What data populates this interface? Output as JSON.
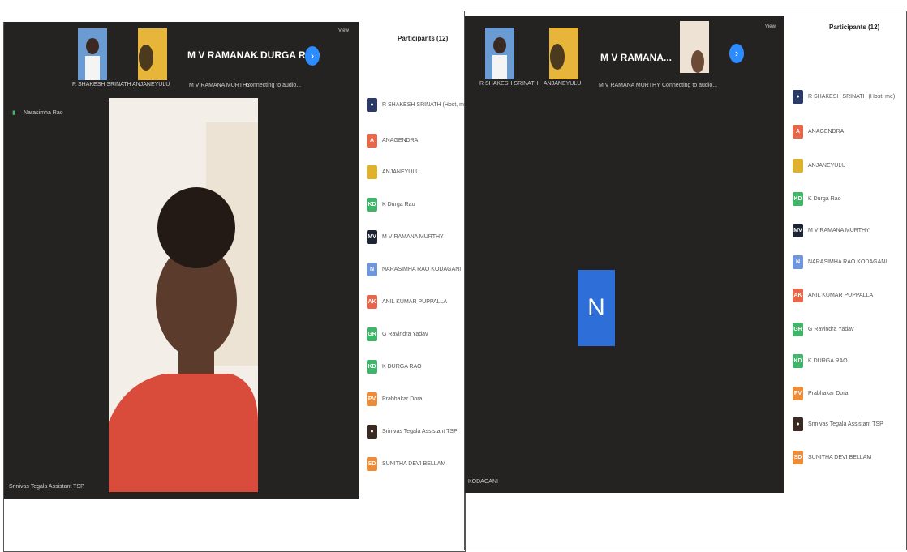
{
  "left": {
    "thumbs": [
      {
        "label": "R SHAKESH SRINATH"
      },
      {
        "label": "ANJANEYULU"
      }
    ],
    "speaker_left": "M V RAMANA...",
    "speaker_right": "K DURGA RAO",
    "sub_labels": [
      "M V RAMANA MURTHY",
      "Connecting to audio..."
    ],
    "view_label": "View",
    "top_status": "Narasimha Rao",
    "bottom_name": "Srinivas Tegala Assistant TSP",
    "participants_title": "Participants (12)",
    "participants": [
      {
        "initials": "",
        "name": "R SHAKESH SRINATH (Host, me)",
        "color": "#2b3a67",
        "type": "photo"
      },
      {
        "initials": "A",
        "name": "ANAGENDRA",
        "color": "#e8674a"
      },
      {
        "initials": "",
        "name": "ANJANEYULU",
        "color": "#e0b02f",
        "type": "sunset"
      },
      {
        "initials": "KD",
        "name": "K Durga Rao",
        "color": "#3fb56a"
      },
      {
        "initials": "MV",
        "name": "M V RAMANA MURTHY",
        "color": "#1d2433"
      },
      {
        "initials": "N",
        "name": "NARASIMHA RAO KODAGANI",
        "color": "#6f95dd"
      },
      {
        "initials": "AK",
        "name": "ANIL KUMAR PUPPALLA",
        "color": "#e8674a"
      },
      {
        "initials": "GR",
        "name": "G Ravindra Yadav",
        "color": "#3fb56a"
      },
      {
        "initials": "KD",
        "name": "K DURGA RAO",
        "color": "#3fb56a"
      },
      {
        "initials": "PV",
        "name": "Prabhakar Dora",
        "color": "#ec8c3b"
      },
      {
        "initials": "",
        "name": "Srinivas Tegala Assistant TSP",
        "color": "#3a2a22",
        "type": "photo"
      },
      {
        "initials": "SD",
        "name": "SUNITHA DEVI BELLAM",
        "color": "#ec8c3b"
      }
    ]
  },
  "right": {
    "thumbs": [
      {
        "label": "R SHAKESH SRINATH"
      },
      {
        "label": "ANJANEYULU"
      }
    ],
    "speaker_left": "M V RAMANA...",
    "sub_labels": [
      "M V RAMANA MURTHY",
      "Connecting to audio..."
    ],
    "view_label": "View",
    "big_initial": "N",
    "bottom_name": "KODAGANI",
    "participants_title": "Participants (12)",
    "participants": [
      {
        "initials": "",
        "name": "R SHAKESH SRINATH (Host, me)",
        "color": "#2b3a67",
        "type": "photo"
      },
      {
        "initials": "A",
        "name": "ANAGENDRA",
        "color": "#e8674a"
      },
      {
        "initials": "",
        "name": "ANJANEYULU",
        "color": "#e0b02f",
        "type": "sunset"
      },
      {
        "initials": "KD",
        "name": "K Durga Rao",
        "color": "#3fb56a"
      },
      {
        "initials": "MV",
        "name": "M V RAMANA MURTHY",
        "color": "#1d2433"
      },
      {
        "initials": "N",
        "name": "NARASIMHA RAO KODAGANI",
        "color": "#6f95dd"
      },
      {
        "initials": "AK",
        "name": "ANIL KUMAR PUPPALLA",
        "color": "#e8674a"
      },
      {
        "initials": "GR",
        "name": "G Ravindra Yadav",
        "color": "#3fb56a"
      },
      {
        "initials": "KD",
        "name": "K DURGA RAO",
        "color": "#3fb56a"
      },
      {
        "initials": "PV",
        "name": "Prabhakar Dora",
        "color": "#ec8c3b"
      },
      {
        "initials": "",
        "name": "Srinivas Tegala Assistant TSP",
        "color": "#3a2a22",
        "type": "photo"
      },
      {
        "initials": "SD",
        "name": "SUNITHA DEVI BELLAM",
        "color": "#ec8c3b"
      }
    ]
  }
}
